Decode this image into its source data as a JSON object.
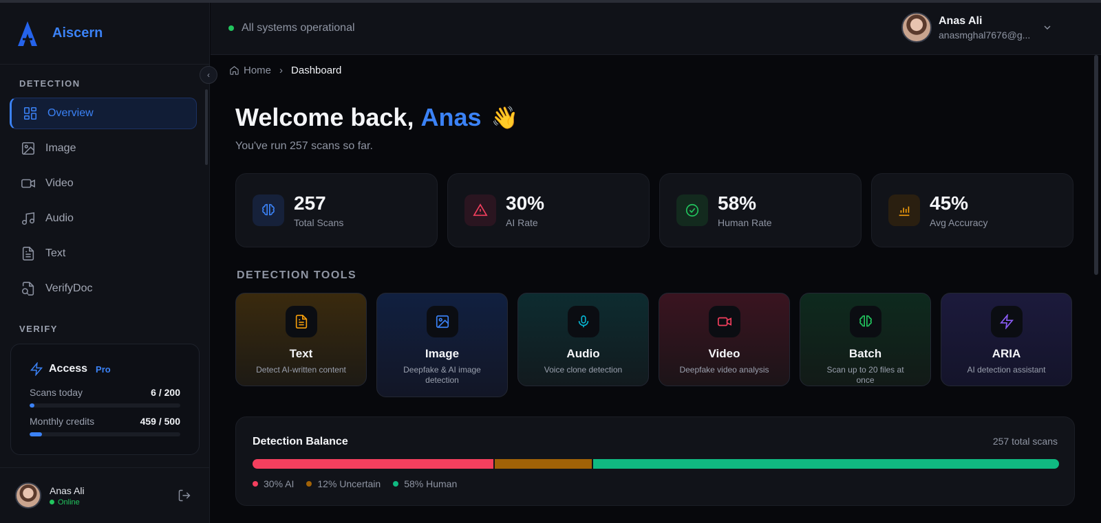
{
  "brand": {
    "name": "Aiscern"
  },
  "header": {
    "status_text": "All systems operational",
    "user_name": "Anas Ali",
    "user_email": "anasmghal7676@g..."
  },
  "sidebar": {
    "section_detection": "DETECTION",
    "section_verify": "VERIFY",
    "items": [
      {
        "label": "Overview",
        "icon": "grid-icon",
        "active": true
      },
      {
        "label": "Image",
        "icon": "image-icon"
      },
      {
        "label": "Video",
        "icon": "video-icon"
      },
      {
        "label": "Audio",
        "icon": "music-icon"
      },
      {
        "label": "Text",
        "icon": "document-icon"
      },
      {
        "label": "VerifyDoc",
        "icon": "verify-doc-icon"
      }
    ],
    "access": {
      "title": "Access",
      "badge": "Pro",
      "scans_label": "Scans today",
      "scans_value": "6 / 200",
      "scans_fraction": 0.03,
      "credits_label": "Monthly credits",
      "credits_value": "459 / 500",
      "credits_fraction": 0.08
    },
    "user": {
      "name": "Anas Ali",
      "status": "Online"
    }
  },
  "breadcrumb": {
    "home": "Home",
    "current": "Dashboard"
  },
  "welcome": {
    "greeting": "Welcome back,",
    "name": "Anas",
    "emoji": "👋",
    "subtitle": "You've run 257 scans so far."
  },
  "stats": [
    {
      "value": "257",
      "label": "Total Scans",
      "icon": "brain-icon",
      "color": "#3b82f6",
      "bg": "#16213a"
    },
    {
      "value": "30%",
      "label": "AI Rate",
      "icon": "warning-icon",
      "color": "#f43f5e",
      "bg": "#2a1520"
    },
    {
      "value": "58%",
      "label": "Human Rate",
      "icon": "check-circle-icon",
      "color": "#22c55e",
      "bg": "#132a1e"
    },
    {
      "value": "45%",
      "label": "Avg Accuracy",
      "icon": "bar-chart-icon",
      "color": "#f59e0b",
      "bg": "#2a1f10"
    }
  ],
  "tools_section": "DETECTION TOOLS",
  "tools": [
    {
      "name": "Text",
      "desc": "Detect AI-written content",
      "icon": "document-icon",
      "color": "#f59e0b",
      "bg": "linear-gradient(180deg,#3a2a0e 0%,#1d1a14 100%)"
    },
    {
      "name": "Image",
      "desc": "Deepfake & AI image detection",
      "icon": "image-icon",
      "color": "#3b82f6",
      "bg": "linear-gradient(180deg,#112040 0%,#121626 100%)"
    },
    {
      "name": "Audio",
      "desc": "Voice clone detection",
      "icon": "mic-icon",
      "color": "#06b6d4",
      "bg": "linear-gradient(180deg,#0d2c30 0%,#121a1e 100%)"
    },
    {
      "name": "Video",
      "desc": "Deepfake video analysis",
      "icon": "video-icon",
      "color": "#f43f5e",
      "bg": "linear-gradient(180deg,#3a1420 0%,#1c1418 100%)"
    },
    {
      "name": "Batch",
      "desc": "Scan up to 20 files at once",
      "icon": "brain-icon",
      "color": "#22c55e",
      "bg": "linear-gradient(180deg,#0e2a1e 0%,#121a17 100%)"
    },
    {
      "name": "ARIA",
      "desc": "AI detection assistant",
      "icon": "lightning-icon",
      "color": "#8b5cf6",
      "bg": "linear-gradient(180deg,#1c1a3c 0%,#14142a 100%)"
    }
  ],
  "balance": {
    "title": "Detection Balance",
    "total": "257 total scans",
    "segments": [
      {
        "label": "30% AI",
        "share": 30,
        "color": "#f43f5e"
      },
      {
        "label": "12% Uncertain",
        "share": 12,
        "color": "#a16207"
      },
      {
        "label": "58% Human",
        "share": 58,
        "color": "#10b981"
      }
    ]
  }
}
